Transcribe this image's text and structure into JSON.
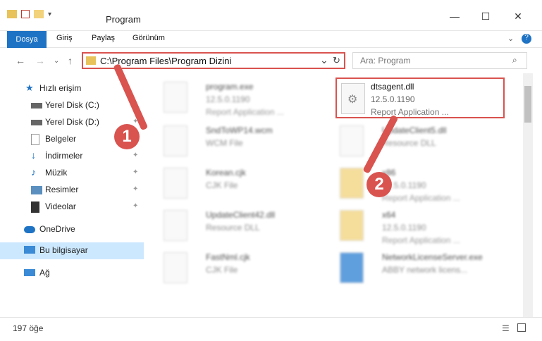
{
  "window": {
    "title": "Program",
    "minimize": "—",
    "maximize": "☐",
    "close": "✕"
  },
  "ribbon": {
    "tabs": [
      "Dosya",
      "Giriş",
      "Paylaş",
      "Görünüm"
    ]
  },
  "address": {
    "path": "C:\\Program Files\\Program Dizini",
    "dropdown": "⌄",
    "refresh": "↻"
  },
  "search": {
    "placeholder": "Ara: Program"
  },
  "sidebar": {
    "items": [
      {
        "label": "Hızlı erişim",
        "icon": "star-icon"
      },
      {
        "label": "Yerel Disk (C:)",
        "icon": "drive-icon"
      },
      {
        "label": "Yerel Disk (D:)",
        "icon": "drive-icon"
      },
      {
        "label": "Belgeler",
        "icon": "documents-icon"
      },
      {
        "label": "İndirmeler",
        "icon": "download-icon"
      },
      {
        "label": "Müzik",
        "icon": "music-icon"
      },
      {
        "label": "Resimler",
        "icon": "pictures-icon"
      },
      {
        "label": "Videolar",
        "icon": "videos-icon"
      },
      {
        "label": "OneDrive",
        "icon": "cloud-icon"
      },
      {
        "label": "Bu bilgisayar",
        "icon": "computer-icon"
      },
      {
        "label": "Ağ",
        "icon": "network-icon"
      }
    ]
  },
  "files": [
    {
      "name": "program.exe",
      "version": "12.5.0.1190",
      "desc": "Report Application ..."
    },
    {
      "name": "dtsagent.dll",
      "version": "12.5.0.1190",
      "desc": "Report Application ..."
    },
    {
      "name": "SndToWP14.wcm",
      "version": "WCM File",
      "desc": ""
    },
    {
      "name": "UpdateClient5.dll",
      "version": "Resource DLL",
      "desc": ""
    },
    {
      "name": "Korean.cjk",
      "version": "CJK File",
      "desc": ""
    },
    {
      "name": "x86",
      "version": "12.5.0.1190",
      "desc": "Report Application ..."
    },
    {
      "name": "UpdateClient42.dll",
      "version": "Resource DLL",
      "desc": ""
    },
    {
      "name": "x64",
      "version": "12.5.0.1190",
      "desc": "Report Application ..."
    },
    {
      "name": "FastNml.cjk",
      "version": "CJK File",
      "desc": ""
    },
    {
      "name": "NetworkLicenseServer.exe",
      "version": "ABBY network licens...",
      "desc": ""
    }
  ],
  "status": {
    "count": "197 öğe"
  },
  "annotations": {
    "badge1": "1",
    "badge2": "2"
  },
  "colors": {
    "accent": "#1e73c4",
    "highlight": "#d9534f"
  }
}
